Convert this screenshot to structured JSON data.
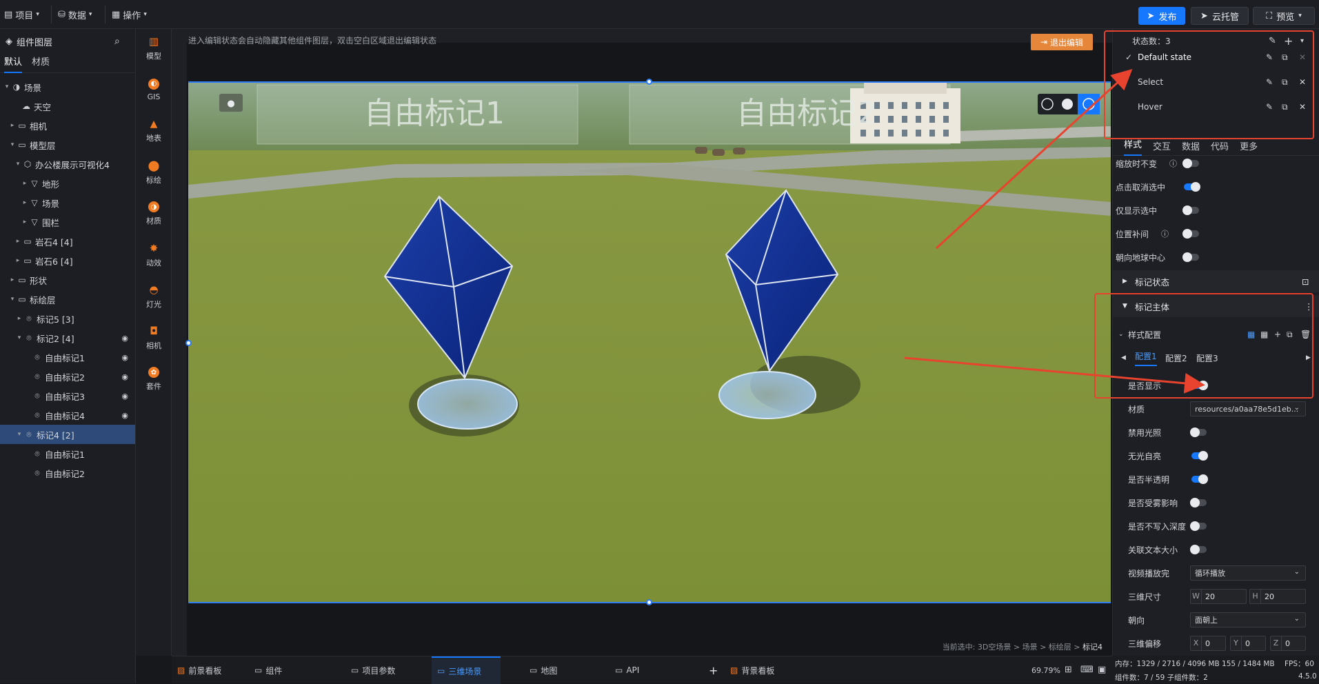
{
  "topbar": {
    "menus": [
      {
        "label": "项目",
        "icon": "file-icon"
      },
      {
        "label": "数据",
        "icon": "database-icon"
      },
      {
        "label": "操作",
        "icon": "grid-icon"
      }
    ],
    "publish": "发布",
    "cloud": "云托管",
    "preview": "预览"
  },
  "layers": {
    "title": "组件图层",
    "tabs": [
      "默认",
      "材质"
    ],
    "items": [
      {
        "label": "场景",
        "icon": "scene-icon"
      },
      {
        "label": "天空",
        "icon": "sky-icon"
      },
      {
        "label": "相机",
        "icon": "folder-icon"
      },
      {
        "label": "模型层",
        "icon": "folder-icon"
      },
      {
        "label": "办公楼展示可视化4",
        "icon": "cube-icon"
      },
      {
        "label": "地形",
        "icon": "triangle-icon"
      },
      {
        "label": "场景",
        "icon": "triangle-icon"
      },
      {
        "label": "围栏",
        "icon": "triangle-icon"
      },
      {
        "label": "岩石4 [4]",
        "icon": "folder-icon"
      },
      {
        "label": "岩石6 [4]",
        "icon": "folder-icon"
      },
      {
        "label": "形状",
        "icon": "folder-icon"
      },
      {
        "label": "标绘层",
        "icon": "folder-icon"
      },
      {
        "label": "标记5 [3]",
        "icon": "marker-icon"
      },
      {
        "label": "标记2 [4]",
        "icon": "marker-icon"
      },
      {
        "label": "自由标记1",
        "icon": "marker-icon"
      },
      {
        "label": "自由标记2",
        "icon": "marker-icon"
      },
      {
        "label": "自由标记3",
        "icon": "marker-icon"
      },
      {
        "label": "自由标记4",
        "icon": "marker-icon"
      },
      {
        "label": "标记4 [2]",
        "icon": "marker-icon"
      },
      {
        "label": "自由标记1",
        "icon": "marker-icon"
      },
      {
        "label": "自由标记2",
        "icon": "marker-icon"
      }
    ]
  },
  "rail": [
    "模型",
    "GIS",
    "地表",
    "标绘",
    "材质",
    "动效",
    "灯光",
    "相机",
    "套件"
  ],
  "canvas": {
    "hint": "进入编辑状态会自动隐藏其他组件图层，双击空白区域退出编辑状态",
    "exit": "退出编辑",
    "label1": "自由标记1",
    "label2": "自由标记2",
    "breadcrumb_prefix": "当前选中: 3D空场景 > 场景 > 标绘层 > ",
    "breadcrumb_current": "标记4"
  },
  "bottom": {
    "tabs": [
      "前景看板",
      "组件",
      "项目参数",
      "三维场景",
      "地图",
      "API",
      "背景看板"
    ],
    "zoom": "69.79%"
  },
  "panel": {
    "state_count": "状态数：3",
    "states": [
      "Default state",
      "Select",
      "Hover"
    ],
    "tabs": [
      "样式",
      "交互",
      "数据",
      "代码",
      "更多"
    ],
    "toggles1": [
      {
        "label": "缩放时不变",
        "on": false
      },
      {
        "label": "点击取消选中",
        "on": true
      },
      {
        "label": "仅显示选中",
        "on": false
      },
      {
        "label": "位置补间",
        "on": false
      },
      {
        "label": "朝向地球中心",
        "on": false
      }
    ],
    "marker_state": "标记状态",
    "marker_body": "标记主体",
    "style_config": "样式配置",
    "configs": [
      "配置1",
      "配置2",
      "配置3"
    ],
    "show_label": "是否显示",
    "material_label": "材质",
    "material_value": "resources/a0aa78e5d1eb...",
    "toggles2": [
      {
        "label": "禁用光照",
        "on": false
      },
      {
        "label": "无光自亮",
        "on": true
      },
      {
        "label": "是否半透明",
        "on": true
      },
      {
        "label": "是否受雾影响",
        "on": false
      },
      {
        "label": "是否不写入深度",
        "on": false
      },
      {
        "label": "关联文本大小",
        "on": false
      }
    ],
    "video_label": "视频播放完",
    "video_value": "循环播放",
    "size_label": "三维尺寸",
    "size_w": "20",
    "size_h": "20",
    "orient_label": "朝向",
    "orient_value": "面朝上",
    "offset_label": "三维偏移",
    "offset_x": "0",
    "offset_y": "0",
    "offset_z": "0"
  },
  "status": {
    "memory": "内存：1329 / 2716 / 4096 MB  155 / 1484 MB",
    "fps": "FPS：60",
    "components": "组件数：7 / 59    子组件数：2",
    "version": "4.5.0"
  },
  "colors": {
    "accent": "#1677ff",
    "annotation": "#e8432e",
    "exit": "#e5863b"
  }
}
